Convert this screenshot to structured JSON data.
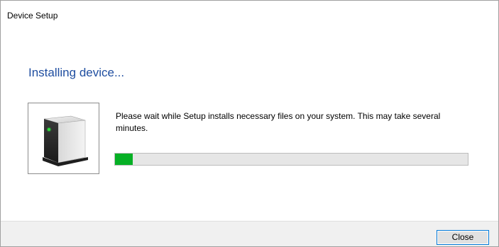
{
  "window": {
    "title": "Device Setup"
  },
  "main": {
    "heading": "Installing device...",
    "device_icon": "device-tower-icon",
    "message": "Please wait while Setup installs necessary files on your system. This may take several minutes.",
    "progress_percent": 5
  },
  "footer": {
    "close_label": "Close"
  },
  "colors": {
    "heading": "#1f4ea0",
    "progress_fill": "#06b025",
    "progress_track": "#e6e6e6",
    "button_border": "#0078d7",
    "footer_bg": "#f0f0f0"
  }
}
